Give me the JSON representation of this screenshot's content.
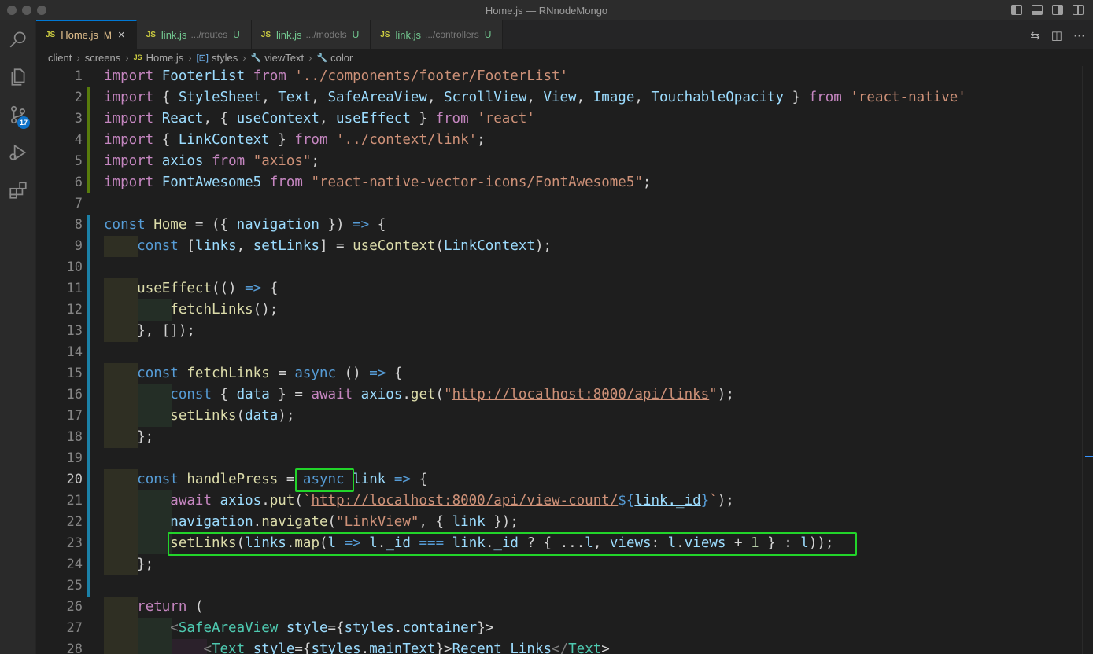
{
  "window": {
    "title": "Home.js — RNnodeMongo"
  },
  "tabs": [
    {
      "icon": "JS",
      "name": "Home.js",
      "path": "",
      "status": "M",
      "active": true
    },
    {
      "icon": "JS",
      "name": "link.js",
      "path": ".../routes",
      "status": "U",
      "active": false
    },
    {
      "icon": "JS",
      "name": "link.js",
      "path": ".../models",
      "status": "U",
      "active": false
    },
    {
      "icon": "JS",
      "name": "link.js",
      "path": ".../controllers",
      "status": "U",
      "active": false
    }
  ],
  "breadcrumb": [
    "client",
    "screens",
    "Home.js",
    "styles",
    "viewText",
    "color"
  ],
  "activity_badge": "17",
  "editor": {
    "line_numbers": [
      "1",
      "2",
      "3",
      "4",
      "5",
      "6",
      "7",
      "8",
      "9",
      "10",
      "11",
      "12",
      "13",
      "14",
      "15",
      "16",
      "17",
      "18",
      "19",
      "20",
      "21",
      "22",
      "23",
      "24",
      "25",
      "26",
      "27",
      "28"
    ],
    "lines": [
      "import FooterList from '../components/footer/FooterList'",
      "import { StyleSheet, Text, SafeAreaView, ScrollView, View, Image, TouchableOpacity } from 'react-native'",
      "import React, { useContext, useEffect } from 'react'",
      "import { LinkContext } from '../context/link';",
      "import axios from \"axios\";",
      "import FontAwesome5 from \"react-native-vector-icons/FontAwesome5\";",
      "",
      "const Home = ({ navigation }) => {",
      "    const [links, setLinks] = useContext(LinkContext);",
      "",
      "    useEffect(() => {",
      "        fetchLinks();",
      "    }, []);",
      "",
      "    const fetchLinks = async () => {",
      "        const { data } = await axios.get(\"http://localhost:8000/api/links\");",
      "        setLinks(data);",
      "    };",
      "",
      "    const handlePress = async link => {",
      "        await axios.put(`http://localhost:8000/api/view-count/${link._id}`);",
      "        navigation.navigate(\"LinkView\", { link });",
      "        setLinks(links.map(l => l._id === link._id ? { ...l, views: l.views + 1 } : l));",
      "    };",
      "",
      "    return (",
      "        <SafeAreaView style={styles.container}>",
      "            <Text style={styles.mainText}>Recent Links</Text>"
    ]
  },
  "colors": {
    "highlight_box": "#22d42a",
    "keyword": "#569cd6",
    "control": "#c586c0",
    "string": "#ce9178",
    "variable": "#9cdcfe",
    "function": "#dcdcaa"
  },
  "icons": {
    "activity": [
      "explorer-icon",
      "search-icon",
      "source-control-icon",
      "run-debug-icon",
      "extensions-icon"
    ]
  }
}
